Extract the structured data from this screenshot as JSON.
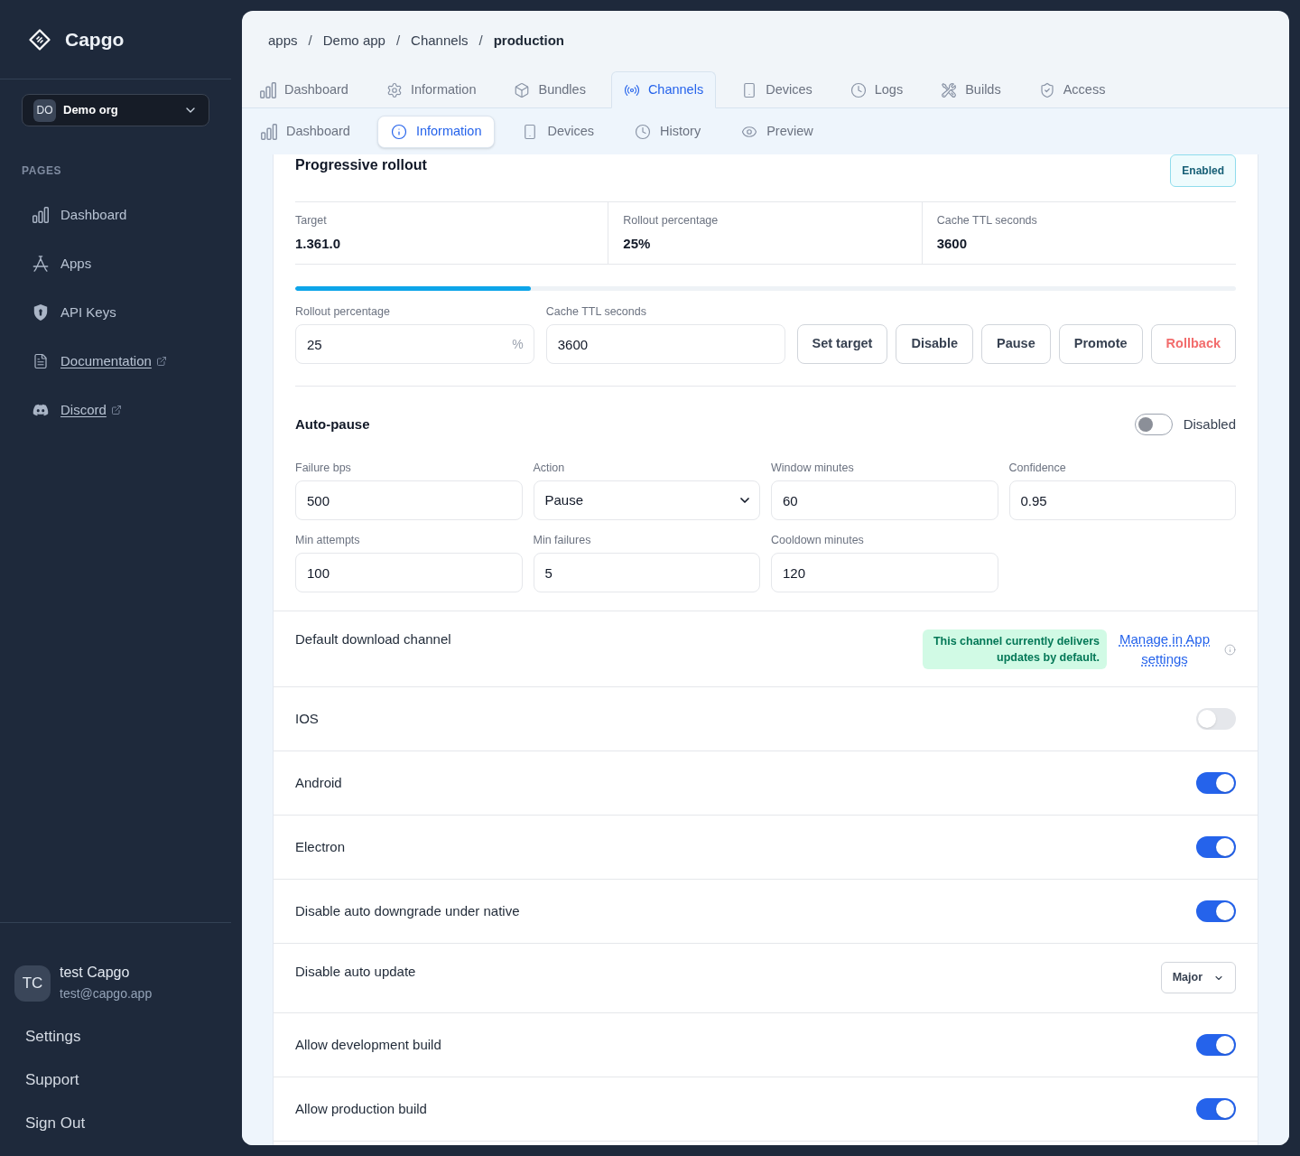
{
  "sidebar": {
    "brand": "Capgo",
    "org": {
      "initials": "DO",
      "name": "Demo org"
    },
    "section_label": "PAGES",
    "items": [
      {
        "label": "Dashboard",
        "external": false
      },
      {
        "label": "Apps",
        "external": false
      },
      {
        "label": "API Keys",
        "external": false
      },
      {
        "label": "Documentation",
        "external": true
      },
      {
        "label": "Discord",
        "external": true
      }
    ],
    "user": {
      "initials": "TC",
      "name": "test Capgo",
      "email": "test@capgo.app"
    },
    "links": [
      "Settings",
      "Support",
      "Sign Out"
    ]
  },
  "breadcrumb": [
    {
      "label": "apps",
      "current": false
    },
    {
      "separator": "/",
      "label": "Demo app",
      "current": false
    },
    {
      "separator": "/",
      "label": "Channels",
      "current": false
    },
    {
      "separator": "/",
      "label": "production",
      "current": true
    }
  ],
  "tabs": [
    {
      "label": "Dashboard",
      "selected": false
    },
    {
      "label": "Information",
      "selected": false
    },
    {
      "label": "Bundles",
      "selected": false
    },
    {
      "label": "Channels",
      "selected": true
    },
    {
      "label": "Devices",
      "selected": false
    },
    {
      "label": "Logs",
      "selected": false
    },
    {
      "label": "Builds",
      "selected": false
    },
    {
      "label": "Access",
      "selected": false
    }
  ],
  "sub_tabs": [
    {
      "label": "Dashboard",
      "selected": false
    },
    {
      "label": "Information",
      "selected": true
    },
    {
      "label": "Devices",
      "selected": false
    },
    {
      "label": "History",
      "selected": false
    },
    {
      "label": "Preview",
      "selected": false
    }
  ],
  "rollout": {
    "title": "Progressive rollout",
    "status_button": "Enabled",
    "stats": [
      {
        "label": "Target",
        "value": "1.361.0"
      },
      {
        "label": "Rollout percentage",
        "value": "25%"
      },
      {
        "label": "Cache TTL seconds",
        "value": "3600"
      }
    ],
    "level": 0.25,
    "fields": [
      {
        "label": "Rollout percentage",
        "value": "25",
        "suffix": "%"
      },
      {
        "label": "Cache TTL seconds",
        "value": "3600"
      }
    ],
    "actions": [
      {
        "label": "Set target",
        "kind": "default"
      },
      {
        "label": "Disable",
        "kind": "default"
      },
      {
        "label": "Pause",
        "kind": "default"
      },
      {
        "label": "Promote",
        "kind": "default"
      },
      {
        "label": "Rollback",
        "kind": "danger"
      }
    ]
  },
  "auto_pause": {
    "title": "Auto-pause",
    "on": false,
    "status": "Disabled",
    "fields": [
      {
        "label": "Failure bps",
        "value": "500",
        "kind": "input"
      },
      {
        "label": "Action",
        "value": "Pause",
        "kind": "select"
      },
      {
        "label": "Window minutes",
        "value": "60",
        "kind": "input"
      },
      {
        "label": "Confidence",
        "value": "0.95",
        "kind": "input"
      },
      {
        "label": "Min attempts",
        "value": "100",
        "kind": "input"
      },
      {
        "label": "Min failures",
        "value": "5",
        "kind": "input"
      },
      {
        "label": "Cooldown minutes",
        "value": "120",
        "kind": "input"
      }
    ]
  },
  "default_channel": {
    "label": "Default download channel",
    "notice": "This channel currently delivers updates by default.",
    "link": "Manage in App settings"
  },
  "settings": [
    {
      "label": "IOS",
      "kind": "toggle",
      "on": false
    },
    {
      "label": "Android",
      "kind": "toggle",
      "on": true
    },
    {
      "label": "Electron",
      "kind": "toggle",
      "on": true
    },
    {
      "label": "Disable auto downgrade under native",
      "kind": "toggle",
      "on": true
    },
    {
      "label": "Disable auto update",
      "kind": "select",
      "value": "Major"
    },
    {
      "label": "Allow development build",
      "kind": "toggle",
      "on": true
    },
    {
      "label": "Allow production build",
      "kind": "toggle",
      "on": true
    }
  ]
}
